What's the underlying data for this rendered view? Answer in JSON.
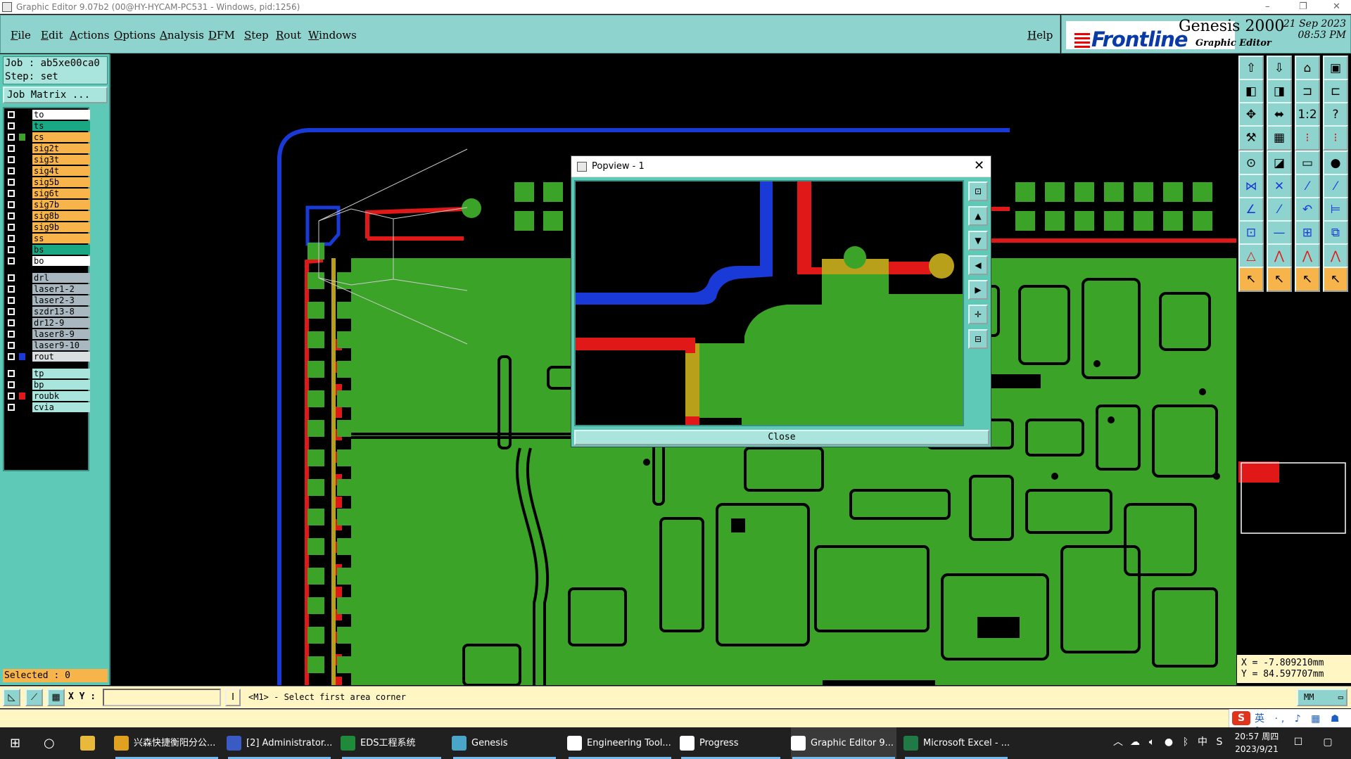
{
  "window": {
    "title": "Graphic Editor 9.07b2 (00@HY-HYCAM-PC531 - Windows, pid:1256)",
    "minimize": "–",
    "restore": "❐",
    "close": "✕"
  },
  "menu": {
    "items": [
      "File",
      "Edit",
      "Actions",
      "Options",
      "Analysis",
      "DFM",
      "Step",
      "Rout",
      "Windows"
    ],
    "help": "Help"
  },
  "logo": {
    "brand": "Frontline",
    "product": "Genesis 2000",
    "subtitle": "Graphic Editor",
    "date_line1": "21 Sep 2023",
    "date_line2": "08:53 PM"
  },
  "job": {
    "job_line": "Job : ab5xe00ca0",
    "step_line": "Step: set",
    "matrix_button": "Job Matrix ..."
  },
  "layers": [
    {
      "name": "to",
      "bg": "#ffffff",
      "swatch": "#000000"
    },
    {
      "name": "ts",
      "bg": "#1aa884",
      "swatch": "#000000"
    },
    {
      "name": "cs",
      "bg": "#f6b44a",
      "swatch": "#3aa328"
    },
    {
      "name": "sig2t",
      "bg": "#f6b44a",
      "swatch": "#000000"
    },
    {
      "name": "sig3t",
      "bg": "#f6b44a",
      "swatch": "#000000"
    },
    {
      "name": "sig4t",
      "bg": "#f6b44a",
      "swatch": "#000000"
    },
    {
      "name": "sig5b",
      "bg": "#f6b44a",
      "swatch": "#000000"
    },
    {
      "name": "sig6t",
      "bg": "#f6b44a",
      "swatch": "#000000"
    },
    {
      "name": "sig7b",
      "bg": "#f6b44a",
      "swatch": "#000000"
    },
    {
      "name": "sig8b",
      "bg": "#f6b44a",
      "swatch": "#000000"
    },
    {
      "name": "sig9b",
      "bg": "#f6b44a",
      "swatch": "#000000"
    },
    {
      "name": "ss",
      "bg": "#f6b44a",
      "swatch": "#000000"
    },
    {
      "name": "bs",
      "bg": "#1aa884",
      "swatch": "#000000"
    },
    {
      "name": "bo",
      "bg": "#ffffff",
      "swatch": "#000000"
    },
    {
      "name": "drl",
      "bg": "#a9b8c0",
      "swatch": "#000000"
    },
    {
      "name": "laser1-2",
      "bg": "#a9b8c0",
      "swatch": "#000000"
    },
    {
      "name": "laser2-3",
      "bg": "#a9b8c0",
      "swatch": "#000000"
    },
    {
      "name": "szdr13-8",
      "bg": "#a9b8c0",
      "swatch": "#000000"
    },
    {
      "name": "dr12-9",
      "bg": "#a9b8c0",
      "swatch": "#000000"
    },
    {
      "name": "laser8-9",
      "bg": "#a9b8c0",
      "swatch": "#000000"
    },
    {
      "name": "laser9-10",
      "bg": "#a9b8c0",
      "swatch": "#000000"
    },
    {
      "name": "rout",
      "bg": "#d8dde0",
      "swatch": "#1a3ad8"
    },
    {
      "name": "tp",
      "bg": "#a9e4dd",
      "swatch": "#000000"
    },
    {
      "name": "bp",
      "bg": "#a9e4dd",
      "swatch": "#000000"
    },
    {
      "name": "roubk",
      "bg": "#a9e4dd",
      "swatch": "#e01818"
    },
    {
      "name": "cvia",
      "bg": "#a9e4dd",
      "swatch": "#000000"
    }
  ],
  "status": {
    "selected": "Selected : 0",
    "xy_label": "X Y :",
    "xy_value": "",
    "prompt": "<M1> - Select first area corner",
    "units": "MM"
  },
  "coords": {
    "x": "X = -7.809210mm",
    "y": "Y = 84.597707mm"
  },
  "popview": {
    "title": "Popview - 1",
    "close_button": "Close"
  },
  "ime": {
    "text": "英 ·, ♪ ▦ ☗ ✎"
  },
  "taskbar": {
    "items": [
      {
        "label": "兴森快捷衡阳分公...",
        "icon_color": "#e0a020"
      },
      {
        "label": "[2] Administrator...",
        "icon_color": "#3b5bc4"
      },
      {
        "label": "EDS工程系统",
        "icon_color": "#1e8a3a"
      },
      {
        "label": "Genesis",
        "icon_color": "#4aa6c8"
      },
      {
        "label": "Engineering Tool...",
        "icon_color": "#ffffff"
      },
      {
        "label": "Progress",
        "icon_color": "#ffffff"
      },
      {
        "label": "Graphic Editor 9...",
        "icon_color": "#ffffff"
      },
      {
        "label": "Microsoft Excel - ...",
        "icon_color": "#1f7a45"
      }
    ],
    "clock_time": "20:57 周四",
    "clock_date": "2023/9/21",
    "tray_lang": "中"
  }
}
